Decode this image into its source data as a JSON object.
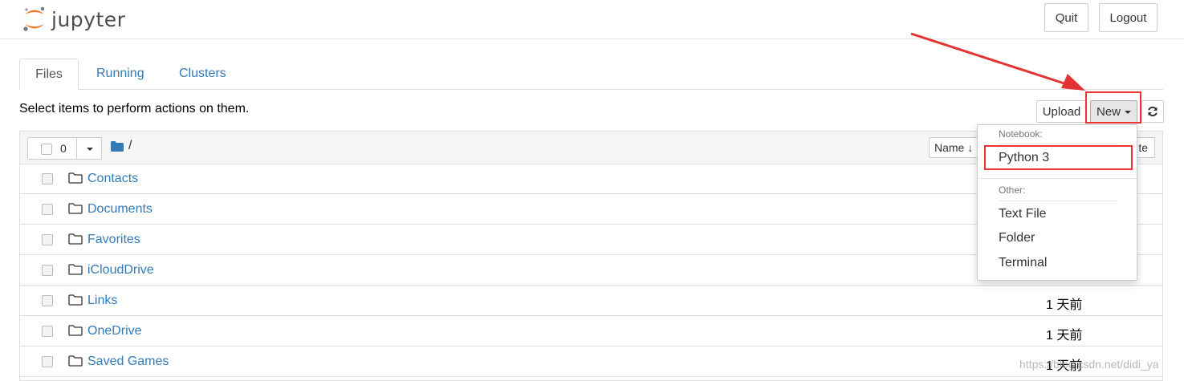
{
  "app": {
    "logo_text": "jupyter",
    "quit_label": "Quit",
    "logout_label": "Logout"
  },
  "tabs": [
    {
      "label": "Files",
      "active": true
    },
    {
      "label": "Running",
      "active": false
    },
    {
      "label": "Clusters",
      "active": false
    }
  ],
  "toolbar": {
    "instructions": "Select items to perform actions on them.",
    "upload_label": "Upload",
    "new_label": "New"
  },
  "list_header": {
    "selected_count": "0",
    "breadcrumb": "/",
    "sort_name_label": "Name",
    "sort_name_arrow": "↓",
    "sort_modified_label": "te"
  },
  "files": [
    {
      "name": "Contacts",
      "time": ""
    },
    {
      "name": "Documents",
      "time": ""
    },
    {
      "name": "Favorites",
      "time": ""
    },
    {
      "name": "iCloudDrive",
      "time": ""
    },
    {
      "name": "Links",
      "time": "1 天前"
    },
    {
      "name": "OneDrive",
      "time": "1 天前"
    },
    {
      "name": "Saved Games",
      "time": "1 天前"
    }
  ],
  "new_menu": {
    "notebook_header": "Notebook:",
    "python_label": "Python 3",
    "other_header": "Other:",
    "text_file_label": "Text File",
    "folder_label": "Folder",
    "terminal_label": "Terminal"
  },
  "watermark": "https://blog.csdn.net/didi_ya",
  "colors": {
    "link": "#337ab7",
    "highlight": "#e33333",
    "logo_orange": "#f37726"
  }
}
